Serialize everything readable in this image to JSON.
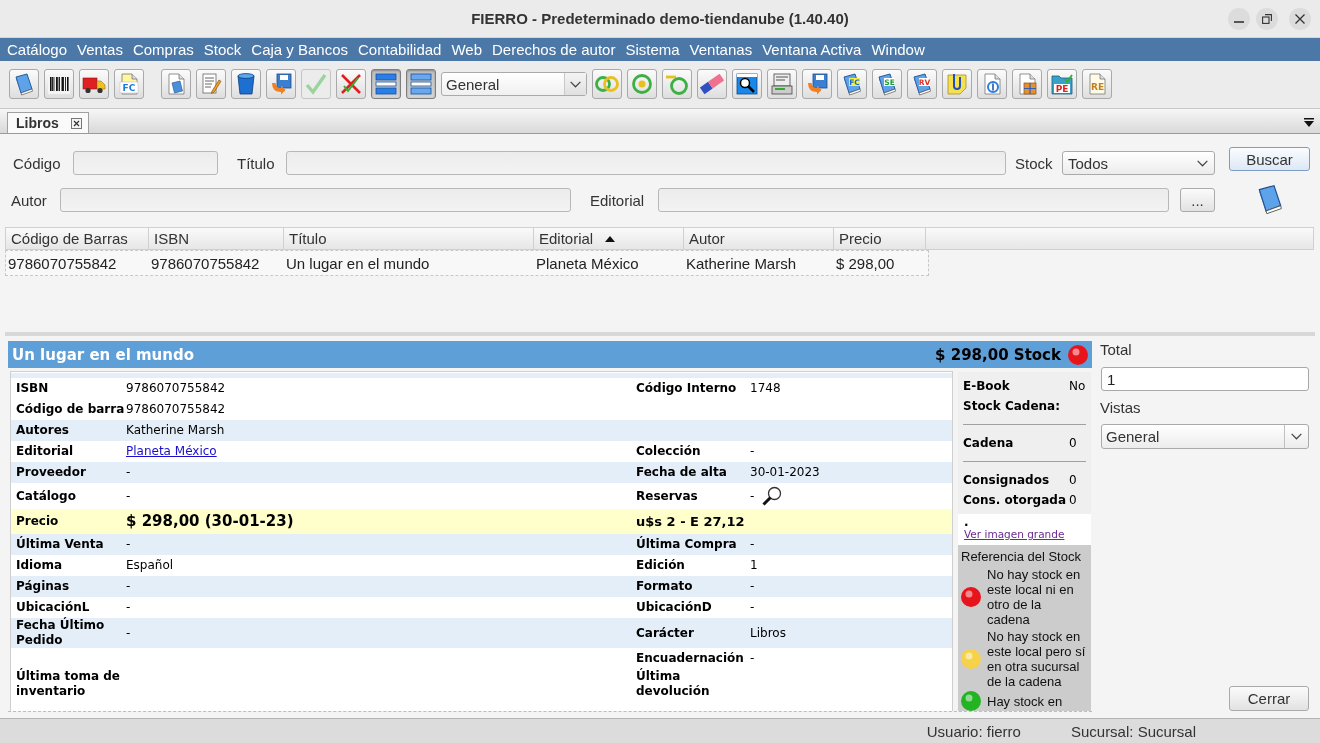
{
  "window": {
    "title": "FIERRO - Predeterminado demo-tiendanube (1.40.40)"
  },
  "menu": [
    "Catálogo",
    "Ventas",
    "Compras",
    "Stock",
    "Caja y Bancos",
    "Contabilidad",
    "Web",
    "Derechos de autor",
    "Sistema",
    "Ventanas",
    "Ventana Activa",
    "Window"
  ],
  "toolbar": {
    "groups": [
      {
        "items": [
          {
            "kind": "button",
            "pressed": false,
            "disabled": false
          },
          {
            "kind": "button",
            "pressed": false,
            "disabled": false
          },
          {
            "kind": "button",
            "pressed": false,
            "disabled": false
          },
          {
            "kind": "button",
            "pressed": false,
            "disabled": false,
            "badge": "FC"
          }
        ]
      },
      {
        "items": [
          {
            "kind": "button",
            "pressed": false,
            "disabled": false
          },
          {
            "kind": "button",
            "pressed": false,
            "disabled": false
          },
          {
            "kind": "button",
            "pressed": false,
            "disabled": false
          },
          {
            "kind": "button",
            "pressed": false,
            "disabled": false
          },
          {
            "kind": "button",
            "pressed": false,
            "disabled": true
          },
          {
            "kind": "button",
            "pressed": false,
            "disabled": false
          },
          {
            "kind": "button",
            "pressed": true,
            "disabled": false
          },
          {
            "kind": "button",
            "pressed": true,
            "disabled": false
          },
          {
            "kind": "combo",
            "value": "General"
          },
          {
            "kind": "button",
            "pressed": false,
            "disabled": false
          },
          {
            "kind": "button",
            "pressed": false,
            "disabled": false
          },
          {
            "kind": "button",
            "pressed": false,
            "disabled": false
          },
          {
            "kind": "button",
            "pressed": false,
            "disabled": false
          },
          {
            "kind": "button",
            "pressed": false,
            "disabled": false
          },
          {
            "kind": "button",
            "pressed": false,
            "disabled": false
          },
          {
            "kind": "button",
            "pressed": false,
            "disabled": false
          },
          {
            "kind": "button",
            "pressed": false,
            "disabled": false,
            "badge": "FC"
          },
          {
            "kind": "button",
            "pressed": false,
            "disabled": false,
            "badge": "SE"
          },
          {
            "kind": "button",
            "pressed": false,
            "disabled": false,
            "badge": "RV"
          },
          {
            "kind": "button",
            "pressed": false,
            "disabled": false
          },
          {
            "kind": "button",
            "pressed": false,
            "disabled": false
          },
          {
            "kind": "button",
            "pressed": false,
            "disabled": false
          },
          {
            "kind": "button",
            "pressed": false,
            "disabled": false,
            "badge": "PE"
          },
          {
            "kind": "button",
            "pressed": false,
            "disabled": false,
            "badge": "RE"
          }
        ]
      }
    ]
  },
  "tabs": [
    {
      "label": "Libros",
      "selected": true
    }
  ],
  "search_form": {
    "code_field": {
      "label": "Código"
    },
    "title_field": {
      "label": "Título"
    },
    "stock_filter": {
      "label": "Stock",
      "value": "Todos"
    },
    "search_button": "Buscar",
    "author_field": {
      "label": "Autor"
    },
    "publisher_field": {
      "label": "Editorial"
    },
    "browse_button": "..."
  },
  "results_table": {
    "columns": [
      {
        "label": "Código de Barras",
        "sorted": false
      },
      {
        "label": "ISBN",
        "sorted": false
      },
      {
        "label": "Título",
        "sorted": false
      },
      {
        "label": "Editorial",
        "sorted": true
      },
      {
        "label": "Autor",
        "sorted": false
      },
      {
        "label": "Precio",
        "sorted": false
      }
    ],
    "rows": [
      {
        "selected": false,
        "cells": [
          "9786070755842",
          "9786070755842",
          "Un lugar en el mundo",
          "Planeta México",
          "Katherine Marsh",
          "$ 298,00"
        ]
      }
    ]
  },
  "detail": {
    "title": "Un lugar en el mundo",
    "header_price": "$ 298,00 Stock",
    "in_stock": false,
    "in_chain": false,
    "rows": [
      {
        "kind": "plain",
        "shaded": false,
        "left": {
          "label": "ISBN",
          "value": "9786070755842",
          "kind": "text"
        },
        "right": {
          "label": "Código Interno",
          "value": "1748",
          "kind": "text"
        }
      },
      {
        "kind": "plain",
        "shaded": false,
        "left": {
          "label": "Código de barra",
          "value": "9786070755842",
          "kind": "text"
        }
      },
      {
        "kind": "plain",
        "shaded": true,
        "left": {
          "label": "Autores",
          "value": "Katherine Marsh",
          "kind": "text"
        }
      },
      {
        "kind": "plain",
        "shaded": false,
        "left": {
          "label": "Editorial",
          "value": "Planeta México",
          "kind": "link"
        },
        "right": {
          "label": "Colección",
          "value": "-",
          "kind": "text"
        }
      },
      {
        "kind": "plain",
        "shaded": true,
        "left": {
          "label": "Proveedor",
          "value": "-",
          "kind": "text"
        },
        "right": {
          "label": "Fecha de alta",
          "value": "30-01-2023",
          "kind": "text"
        }
      },
      {
        "kind": "plain",
        "shaded": false,
        "left": {
          "label": "Catálogo",
          "value": "-",
          "kind": "text"
        },
        "right": {
          "label": "Reservas",
          "value": "-",
          "kind": "lookup"
        }
      },
      {
        "kind": "price",
        "left": {
          "label": "Precio",
          "value": "$ 298,00 (30-01-23)"
        },
        "right": {
          "label": "u$s 2 - E 27,12"
        }
      },
      {
        "kind": "plain",
        "shaded": true,
        "left": {
          "label": "Última Venta",
          "value": "-",
          "kind": "text"
        },
        "right": {
          "label": "Última Compra",
          "value": "-",
          "kind": "text"
        }
      },
      {
        "kind": "plain",
        "shaded": false,
        "left": {
          "label": "Idioma",
          "value": "Español",
          "kind": "text"
        },
        "right": {
          "label": "Edición",
          "value": "1",
          "kind": "text"
        }
      },
      {
        "kind": "plain",
        "shaded": true,
        "left": {
          "label": "Páginas",
          "value": "-",
          "kind": "text"
        },
        "right": {
          "label": "Formato",
          "value": "-",
          "kind": "text"
        }
      },
      {
        "kind": "plain",
        "shaded": false,
        "left": {
          "label": "UbicaciónL",
          "value": "-",
          "kind": "text"
        },
        "right": {
          "label": "UbicaciónD",
          "value": "-",
          "kind": "text"
        }
      },
      {
        "kind": "plain",
        "shaded": true,
        "left": {
          "label": "Fecha Último Pedido",
          "value": "-",
          "kind": "text"
        },
        "right": {
          "label": "Carácter",
          "value": "Libros",
          "kind": "text"
        }
      },
      {
        "kind": "plain",
        "shaded": false,
        "right": {
          "label": "Encuadernación",
          "value": "-",
          "kind": "text"
        }
      },
      {
        "kind": "plain",
        "shaded": false,
        "left": {
          "label": "Última toma de inventario"
        },
        "right": {
          "label": "Última devolución"
        }
      }
    ]
  },
  "stock_info": {
    "sections": [
      {
        "items": [
          {
            "label": "E-Book",
            "value": "No"
          },
          {
            "label": "Stock Cadena:"
          }
        ]
      },
      {
        "items": [
          {
            "label": "Cadena",
            "value": "0"
          }
        ]
      },
      {
        "items": [
          {
            "label": "Consignados",
            "value": "0"
          },
          {
            "label": "Cons. otorgada",
            "value": "0"
          }
        ]
      }
    ]
  },
  "image_mark": ".",
  "image_link": "Ver imagen grande",
  "stock_legend": {
    "title": "Referencia del Stock",
    "items": [
      {
        "color": "#e8141c",
        "text": "No hay stock en este local ni en otro de la cadena"
      },
      {
        "color": "#f5d24a",
        "text": "No hay stock en este local pero sí en otra sucursal de la cadena"
      },
      {
        "color": "#22b422",
        "text": "Hay stock en"
      }
    ]
  },
  "side_panel": {
    "total": {
      "label": "Total",
      "value": "1"
    },
    "views": {
      "label": "Vistas",
      "value": "General"
    },
    "close_button": "Cerrar"
  },
  "status_bar": {
    "user": "Usuario: fierro",
    "branch": "Sucursal: Sucursal"
  }
}
